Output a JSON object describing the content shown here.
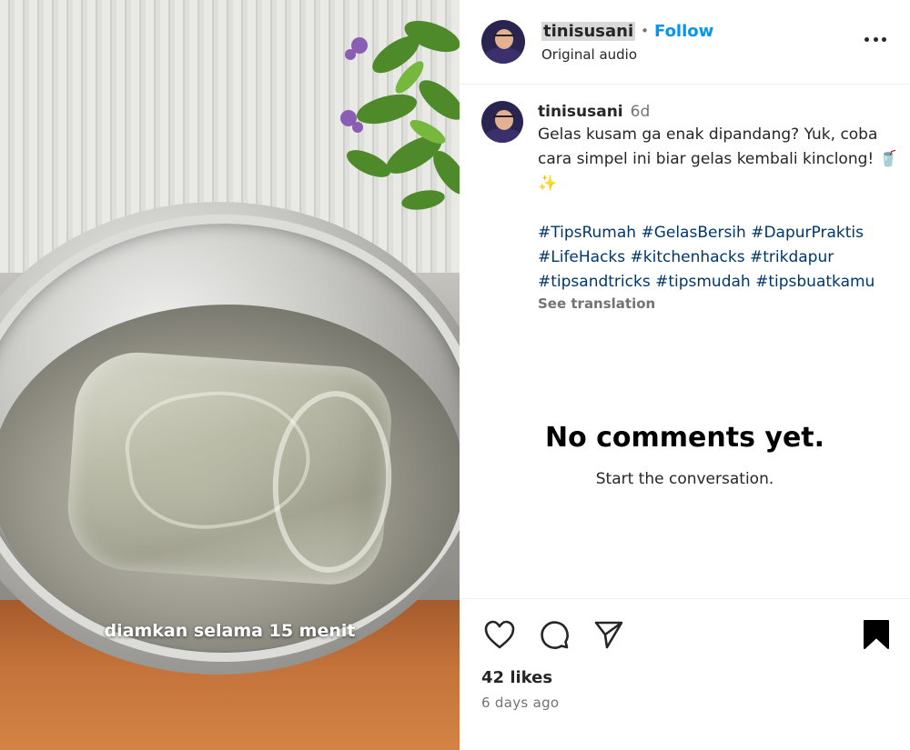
{
  "post": {
    "username": "tinisusani",
    "separator": "•",
    "follow_label": "Follow",
    "audio_label": "Original audio",
    "video_caption_overlay": "diamkan selama 15 menit"
  },
  "caption": {
    "username": "tinisusani",
    "time": "6d",
    "text": "Gelas kusam ga enak dipandang? Yuk, coba cara simpel ini biar gelas kembali kinclong! 🥤 ✨",
    "hashtags": "#TipsRumah #GelasBersih #DapurPraktis #LifeHacks #kitchenhacks #trikdapur #tipsandtricks #tipsmudah #tipsbuatkamu",
    "see_translation": "See translation"
  },
  "comments": {
    "empty_title": "No comments yet.",
    "empty_subtitle": "Start the conversation."
  },
  "footer": {
    "likes": "42 likes",
    "time_ago": "6 days ago"
  },
  "icons": {
    "like": "heart-icon",
    "comment": "comment-bubble-icon",
    "share": "paper-plane-icon",
    "save": "bookmark-filled-icon",
    "more": "more-horizontal-icon"
  },
  "colors": {
    "follow_blue": "#0095f6",
    "hashtag": "#00376b",
    "secondary_text": "#737373"
  }
}
